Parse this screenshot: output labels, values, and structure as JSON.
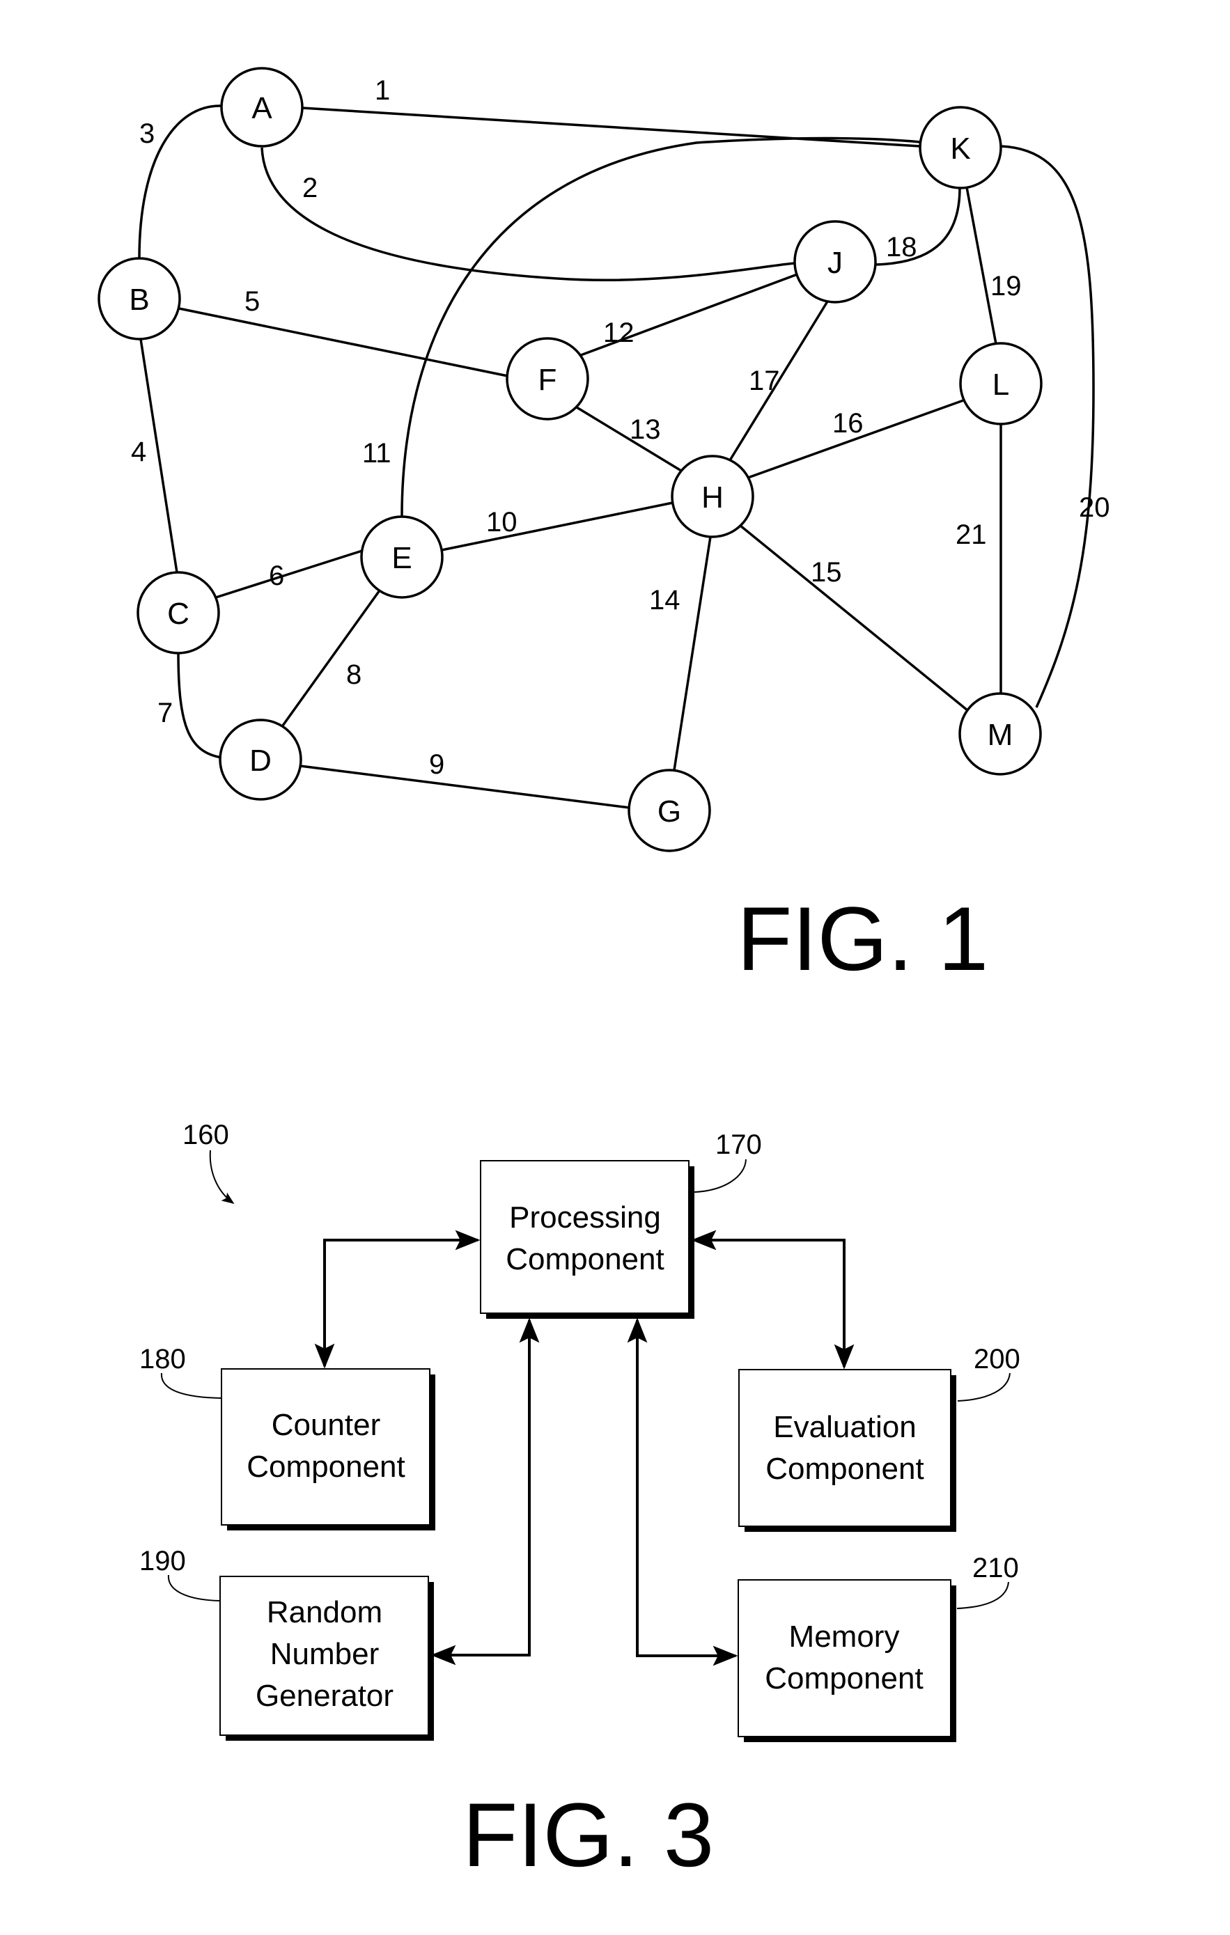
{
  "figure1": {
    "title": "FIG. 1",
    "nodes": [
      {
        "id": "A",
        "label": "A"
      },
      {
        "id": "B",
        "label": "B"
      },
      {
        "id": "C",
        "label": "C"
      },
      {
        "id": "D",
        "label": "D"
      },
      {
        "id": "E",
        "label": "E"
      },
      {
        "id": "F",
        "label": "F"
      },
      {
        "id": "G",
        "label": "G"
      },
      {
        "id": "H",
        "label": "H"
      },
      {
        "id": "J",
        "label": "J"
      },
      {
        "id": "K",
        "label": "K"
      },
      {
        "id": "L",
        "label": "L"
      },
      {
        "id": "M",
        "label": "M"
      }
    ],
    "edges": [
      {
        "label": "1",
        "from": "A",
        "to": "K"
      },
      {
        "label": "2",
        "from": "A",
        "to": "J"
      },
      {
        "label": "3",
        "from": "A",
        "to": "B"
      },
      {
        "label": "4",
        "from": "B",
        "to": "C"
      },
      {
        "label": "5",
        "from": "B",
        "to": "F"
      },
      {
        "label": "6",
        "from": "C",
        "to": "E"
      },
      {
        "label": "7",
        "from": "C",
        "to": "D"
      },
      {
        "label": "8",
        "from": "D",
        "to": "E"
      },
      {
        "label": "9",
        "from": "D",
        "to": "G"
      },
      {
        "label": "10",
        "from": "E",
        "to": "H"
      },
      {
        "label": "11",
        "from": "E",
        "to": "K"
      },
      {
        "label": "12",
        "from": "F",
        "to": "J"
      },
      {
        "label": "13",
        "from": "F",
        "to": "H"
      },
      {
        "label": "14",
        "from": "H",
        "to": "G"
      },
      {
        "label": "15",
        "from": "H",
        "to": "M"
      },
      {
        "label": "16",
        "from": "H",
        "to": "L"
      },
      {
        "label": "17",
        "from": "H",
        "to": "J"
      },
      {
        "label": "18",
        "from": "J",
        "to": "K"
      },
      {
        "label": "19",
        "from": "K",
        "to": "L"
      },
      {
        "label": "20",
        "from": "K",
        "to": "M"
      },
      {
        "label": "21",
        "from": "L",
        "to": "M"
      }
    ]
  },
  "figure3": {
    "title": "FIG. 3",
    "system_ref": "160",
    "components": [
      {
        "id": "processing",
        "ref": "170",
        "lines": [
          "Processing",
          "Component"
        ]
      },
      {
        "id": "counter",
        "ref": "180",
        "lines": [
          "Counter",
          "Component"
        ]
      },
      {
        "id": "rng",
        "ref": "190",
        "lines": [
          "Random",
          "Number",
          "Generator"
        ]
      },
      {
        "id": "evaluation",
        "ref": "200",
        "lines": [
          "Evaluation",
          "Component"
        ]
      },
      {
        "id": "memory",
        "ref": "210",
        "lines": [
          "Memory",
          "Component"
        ]
      }
    ],
    "connections": [
      {
        "from": "processing",
        "to": "counter",
        "bidirectional": true
      },
      {
        "from": "processing",
        "to": "evaluation",
        "bidirectional": true
      },
      {
        "from": "processing",
        "to": "rng",
        "bidirectional": true
      },
      {
        "from": "processing",
        "to": "memory",
        "bidirectional": true
      }
    ]
  }
}
